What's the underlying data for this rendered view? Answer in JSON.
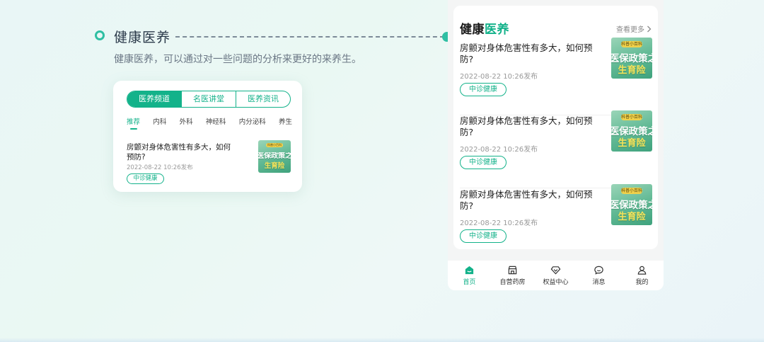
{
  "section": {
    "title": "健康医养",
    "description": "健康医养，可以通过对一些问题的分析来更好的来养生。"
  },
  "mini_card": {
    "tabs": [
      {
        "label": "医养频道",
        "active": true
      },
      {
        "label": "名医讲堂",
        "active": false
      },
      {
        "label": "医养资讯",
        "active": false
      }
    ],
    "categories": [
      "推荐",
      "内科",
      "外科",
      "神经科",
      "内分泌科",
      "养生"
    ],
    "article": {
      "title": "房颤对身体危害性有多大，如何预防?",
      "date": "2022-08-22 10:26发布",
      "tag": "中诊健康"
    }
  },
  "thumbnail": {
    "badge": "科普小百科",
    "main": "医保政策之",
    "sub": "生育险"
  },
  "feed": {
    "title_part1": "健康",
    "title_part2": "医养",
    "more_label": "查看更多",
    "articles": [
      {
        "title": "房颤对身体危害性有多大，如何预防?",
        "date": "2022-08-22 10:26发布",
        "tag": "中诊健康"
      },
      {
        "title": "房颤对身体危害性有多大，如何预防?",
        "date": "2022-08-22 10:26发布",
        "tag": "中诊健康"
      },
      {
        "title": "房颤对身体危害性有多大，如何预防?",
        "date": "2022-08-22 10:26发布",
        "tag": "中诊健康"
      }
    ]
  },
  "tabbar": [
    {
      "label": "首页",
      "icon": "home-icon",
      "active": true
    },
    {
      "label": "自营药房",
      "icon": "pharmacy-store-icon",
      "active": false
    },
    {
      "label": "权益中心",
      "icon": "diamond-heart-icon",
      "active": false
    },
    {
      "label": "消息",
      "icon": "message-bubble-icon",
      "active": false
    },
    {
      "label": "我的",
      "icon": "user-icon",
      "active": false
    }
  ],
  "colors": {
    "accent": "#13b28a",
    "accent_light": "#2fbfa3",
    "thumb_badge": "#f0d14b",
    "thumb_sub": "#f6e35a"
  }
}
